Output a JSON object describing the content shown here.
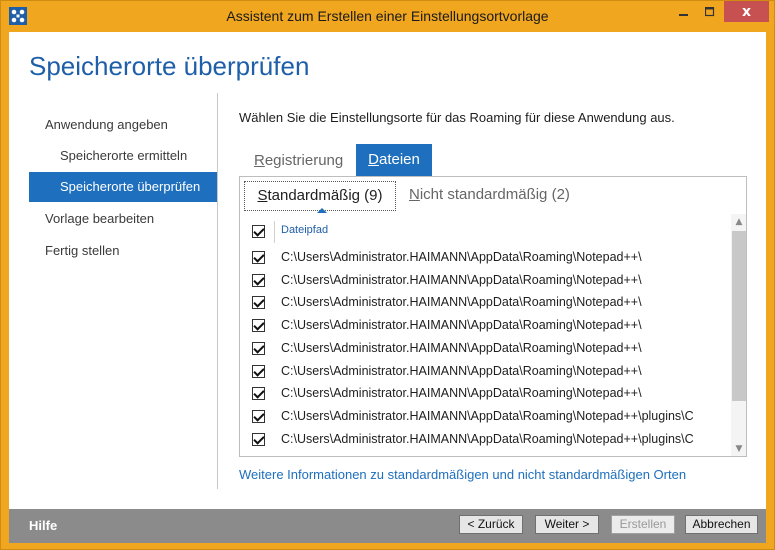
{
  "window": {
    "title": "Assistent zum Erstellen einer Einstellungsortvorlage",
    "close_glyph": "x"
  },
  "header": {
    "title": "Speicherorte überprüfen"
  },
  "nav": {
    "items": [
      {
        "label": "Anwendung angeben"
      },
      {
        "label": "Speicherorte ermitteln"
      },
      {
        "label": "Speicherorte überprüfen"
      },
      {
        "label": "Vorlage bearbeiten"
      },
      {
        "label": "Fertig stellen"
      }
    ]
  },
  "main": {
    "instruction": "Wählen Sie die Einstellungsorte für das Roaming für diese Anwendung aus.",
    "tabs": [
      {
        "label_prefix": "R",
        "label_rest": "egistrierung"
      },
      {
        "label_prefix": "D",
        "label_rest": "ateien"
      }
    ],
    "subtabs": [
      {
        "label_prefix": "S",
        "label_rest": "tandardmäßig (9)"
      },
      {
        "label_prefix": "N",
        "label_rest": "icht standardmäßig (2)"
      }
    ],
    "column_header": "Dateipfad",
    "rows": [
      {
        "path": "C:\\Users\\Administrator.HAIMANN\\AppData\\Roaming\\Notepad++\\"
      },
      {
        "path": "C:\\Users\\Administrator.HAIMANN\\AppData\\Roaming\\Notepad++\\"
      },
      {
        "path": "C:\\Users\\Administrator.HAIMANN\\AppData\\Roaming\\Notepad++\\"
      },
      {
        "path": "C:\\Users\\Administrator.HAIMANN\\AppData\\Roaming\\Notepad++\\"
      },
      {
        "path": "C:\\Users\\Administrator.HAIMANN\\AppData\\Roaming\\Notepad++\\"
      },
      {
        "path": "C:\\Users\\Administrator.HAIMANN\\AppData\\Roaming\\Notepad++\\"
      },
      {
        "path": "C:\\Users\\Administrator.HAIMANN\\AppData\\Roaming\\Notepad++\\"
      },
      {
        "path": "C:\\Users\\Administrator.HAIMANN\\AppData\\Roaming\\Notepad++\\plugins\\C"
      },
      {
        "path": "C:\\Users\\Administrator.HAIMANN\\AppData\\Roaming\\Notepad++\\plugins\\C"
      }
    ],
    "more_link": "Weitere Informationen zu standardmäßigen und nicht standardmäßigen Orten"
  },
  "footer": {
    "help": "Hilfe",
    "back": "< Zurück",
    "next": "Weiter >",
    "create": "Erstellen",
    "cancel": "Abbrechen"
  },
  "colors": {
    "accent": "#1e6fbd",
    "titlebar": "#f0a61e",
    "close_button": "#c75050",
    "footer": "#8b8b8b"
  }
}
